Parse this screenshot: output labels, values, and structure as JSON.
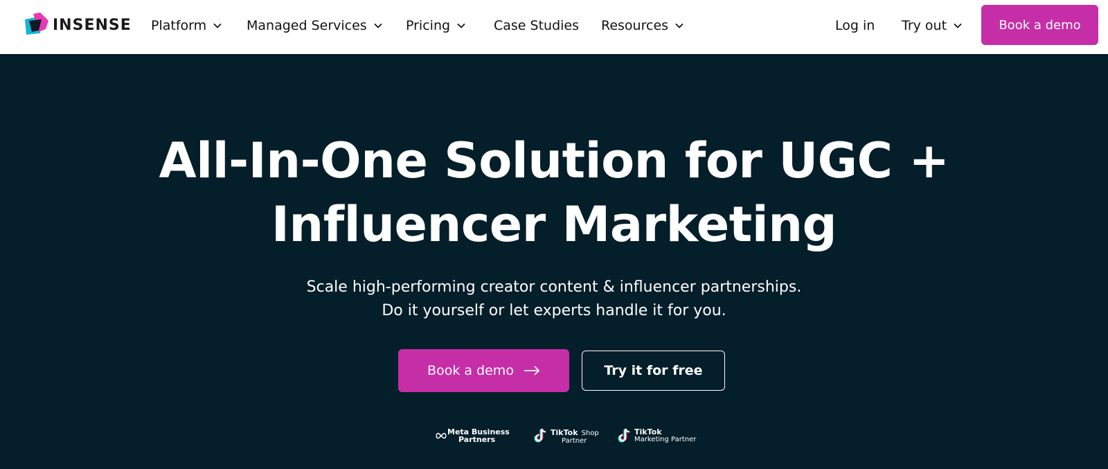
{
  "header": {
    "logo_text": "INSENSE",
    "nav": [
      {
        "label": "Platform",
        "has_dropdown": true
      },
      {
        "label": "Managed Services",
        "has_dropdown": true
      },
      {
        "label": "Pricing",
        "has_dropdown": true
      },
      {
        "label": "Case Studies",
        "has_dropdown": false
      },
      {
        "label": "Resources",
        "has_dropdown": true
      }
    ],
    "login": "Log in",
    "try_out": "Try out",
    "book_demo": "Book a demo"
  },
  "hero": {
    "title_line1": "All-In-One Solution for UGC +",
    "title_line2": "Influencer Marketing",
    "subtitle_line1": "Scale high-performing creator content & influencer partnerships.",
    "subtitle_line2": "Do it yourself or let experts handle it for you.",
    "primary_cta": "Book a demo",
    "secondary_cta": "Try it for free"
  },
  "partners": {
    "meta_line1": "Meta Business",
    "meta_line2": "Partners",
    "tiktok_shop_brand": "TikTok",
    "tiktok_shop_suffix": "Shop",
    "tiktok_shop_line2": "Partner",
    "tiktok_marketing_brand": "TikTok",
    "tiktok_marketing_line2": "Marketing Partner"
  },
  "colors": {
    "accent": "#c62ea7",
    "hero_bg": "#041e2a",
    "header_bg": "#ffffff"
  }
}
